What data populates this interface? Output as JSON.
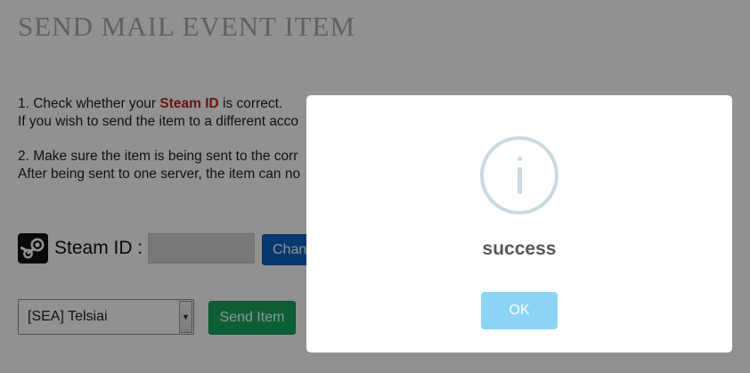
{
  "page": {
    "title": "SEND MAIL EVENT ITEM",
    "instructions": {
      "step1_prefix": "1. Check whether your ",
      "step1_highlight": "Steam ID",
      "step1_suffix": " is correct.",
      "step1_line2": "If you wish to send the item to a different acco",
      "step2_line1": "2. Make sure the item is being sent to the corr",
      "step2_line2": "After being sent to one server, the item can no"
    },
    "steam": {
      "label": "Steam ID :",
      "value": "",
      "change_button": "Change"
    },
    "server_select": {
      "selected": "[SEA] Telsiai"
    },
    "send_button": "Send Item"
  },
  "modal": {
    "icon": "info-icon",
    "message": "success",
    "ok_button": "OK"
  },
  "colors": {
    "highlight": "#c81e1e",
    "change_button": "#0e63c3",
    "send_button": "#1aa762",
    "ok_button": "#8cd4f5",
    "info_icon": "#c9dae1"
  }
}
